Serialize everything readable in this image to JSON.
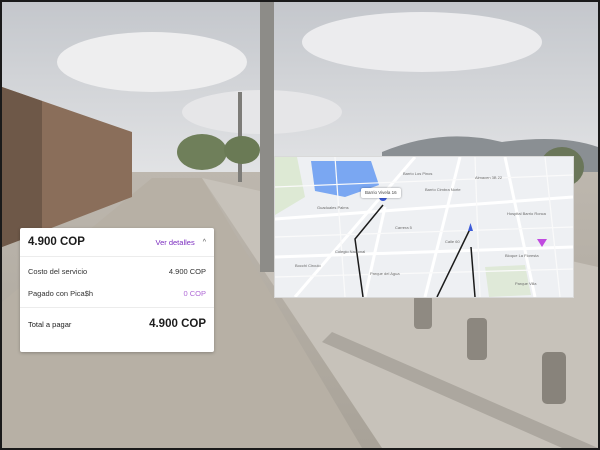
{
  "payment": {
    "total_header": "4.900 COP",
    "details_link": "Ver detalles",
    "chevron_glyph": "^",
    "rows": [
      {
        "label": "Costo del servicio",
        "value": "4.900 COP"
      },
      {
        "label": "Pagado con Pica$h",
        "value": "0 COP"
      }
    ],
    "total_label": "Total a pagar",
    "total_value": "4.900 COP"
  },
  "map": {
    "tooltip": "Barrio Vivela 16",
    "labels": [
      "Guaduales Palms",
      "Barrio Los Pinos",
      "Almacen 3B 22",
      "Barrio Cimbra Norte",
      "Colegio Nacional",
      "Parque del Agua",
      "Hospital Barrio Ronca",
      "Calle 60",
      "Carrera 5",
      "Bocchi Circulo",
      "Parque Villa",
      "Bloque La Floresta"
    ],
    "colors": {
      "water": "#7aa7f2",
      "pin": "#3d5bd8",
      "destination": "#c04ae0",
      "road": "#ffffff",
      "land": "#eef0f3"
    },
    "icons": [
      "location-pin-icon",
      "destination-marker-icon"
    ]
  }
}
